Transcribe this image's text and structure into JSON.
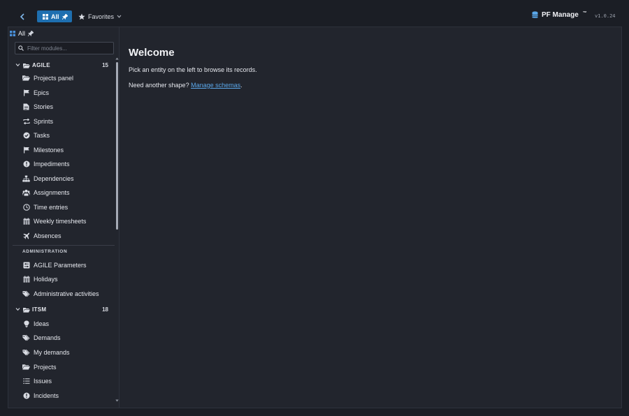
{
  "topbar": {
    "all_label": "All",
    "favorites_label": "Favorites",
    "brand": "PF Manage",
    "brand_mark": "™",
    "version": "v1.0.24"
  },
  "sidebar": {
    "header_label": "All",
    "filter_placeholder": "Filter modules...",
    "groups": [
      {
        "name": "AGILE",
        "count": "15",
        "items": [
          {
            "label": "Projects panel",
            "icon": "folder-open-icon"
          },
          {
            "label": "Epics",
            "icon": "flag-icon"
          },
          {
            "label": "Stories",
            "icon": "document-icon"
          },
          {
            "label": "Sprints",
            "icon": "repeat-icon"
          },
          {
            "label": "Tasks",
            "icon": "check-circle-icon"
          },
          {
            "label": "Milestones",
            "icon": "flag-icon"
          },
          {
            "label": "Impediments",
            "icon": "exclamation-circle-icon"
          },
          {
            "label": "Dependencies",
            "icon": "sitemap-icon"
          },
          {
            "label": "Assignments",
            "icon": "users-icon"
          },
          {
            "label": "Time entries",
            "icon": "clock-icon"
          },
          {
            "label": "Weekly timesheets",
            "icon": "calendar-icon"
          },
          {
            "label": "Absences",
            "icon": "plane-icon"
          }
        ],
        "section_label": "ADMINISTRATION",
        "admin_items": [
          {
            "label": "AGILE Parameters",
            "icon": "sliders-icon"
          },
          {
            "label": "Holidays",
            "icon": "calendar-icon"
          },
          {
            "label": "Administrative activities",
            "icon": "tags-icon"
          }
        ]
      },
      {
        "name": "ITSM",
        "count": "18",
        "items": [
          {
            "label": "Ideas",
            "icon": "lightbulb-icon"
          },
          {
            "label": "Demands",
            "icon": "tags-icon"
          },
          {
            "label": "My demands",
            "icon": "tags-icon"
          },
          {
            "label": "Projects",
            "icon": "folder-open-icon"
          },
          {
            "label": "Issues",
            "icon": "list-icon"
          },
          {
            "label": "Incidents",
            "icon": "exclamation-circle-icon"
          }
        ]
      }
    ]
  },
  "main": {
    "title": "Welcome",
    "line1": "Pick an entity on the left to browse its records.",
    "line2_prefix": "Need another shape? ",
    "line2_link": "Manage schemas",
    "line2_suffix": "."
  },
  "colors": {
    "background": "#1b1e25",
    "panel": "#22252d",
    "accent": "#1e6fb0",
    "link": "#5aa6e8"
  }
}
